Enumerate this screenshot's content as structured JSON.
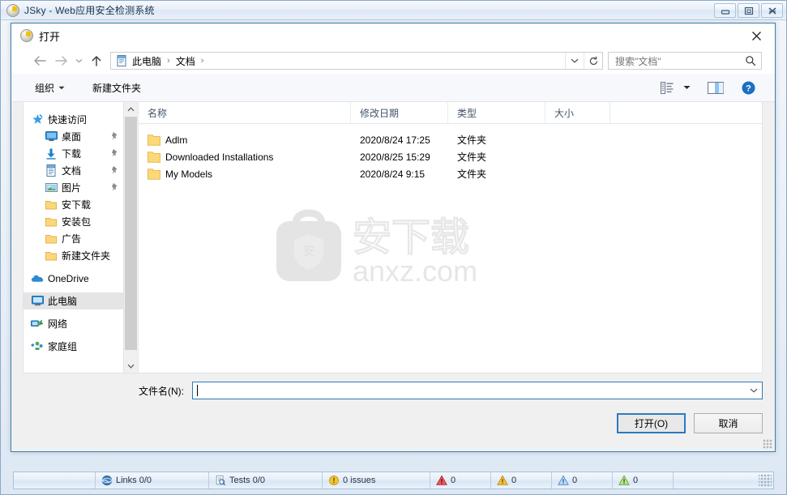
{
  "app": {
    "title": "JSky - Web应用安全检测系统",
    "icon": "jsky-app-icon",
    "window_controls": [
      {
        "name": "minimize-button",
        "glyph": "minimize-icon"
      },
      {
        "name": "maximize-button",
        "glyph": "maximize-icon"
      },
      {
        "name": "close-button",
        "glyph": "close-icon"
      }
    ]
  },
  "dialog": {
    "title": "打开",
    "icon": "jsky-app-icon",
    "close_label": "✕",
    "nav": {
      "back_icon": "arrow-left-icon",
      "forward_icon": "arrow-right-icon",
      "recent_icon": "chevron-down-icon",
      "up_icon": "arrow-up-icon"
    },
    "address": {
      "icon": "documents-icon",
      "crumbs": [
        "此电脑",
        "文档"
      ],
      "separator": "›",
      "dropdown_icon": "chevron-down-icon",
      "refresh_icon": "refresh-icon"
    },
    "search": {
      "placeholder": "搜索\"文档\"",
      "icon": "search-icon"
    },
    "toolbar": {
      "organize": "组织",
      "organize_caret": "▼",
      "new_folder": "新建文件夹",
      "view_icon": "view-list-icon",
      "view_caret": "▼",
      "preview_icon": "preview-pane-icon",
      "help_icon": "help-icon"
    },
    "nav_pane": {
      "items": [
        {
          "label": "快速访问",
          "icon": "quick-access-star-icon",
          "level": 1,
          "pinned": false,
          "selected": false
        },
        {
          "label": "桌面",
          "icon": "desktop-icon",
          "level": 2,
          "pinned": true,
          "selected": false
        },
        {
          "label": "下载",
          "icon": "downloads-icon",
          "level": 2,
          "pinned": true,
          "selected": false
        },
        {
          "label": "文档",
          "icon": "documents-icon",
          "level": 2,
          "pinned": true,
          "selected": false
        },
        {
          "label": "图片",
          "icon": "pictures-icon",
          "level": 2,
          "pinned": true,
          "selected": false
        },
        {
          "label": "安下载",
          "icon": "folder-icon",
          "level": 2,
          "pinned": false,
          "selected": false
        },
        {
          "label": "安装包",
          "icon": "folder-icon",
          "level": 2,
          "pinned": false,
          "selected": false
        },
        {
          "label": "广告",
          "icon": "folder-icon",
          "level": 2,
          "pinned": false,
          "selected": false
        },
        {
          "label": "新建文件夹",
          "icon": "folder-icon",
          "level": 2,
          "pinned": false,
          "selected": false
        },
        {
          "label": "OneDrive",
          "icon": "onedrive-cloud-icon",
          "level": 1,
          "pinned": false,
          "selected": false
        },
        {
          "label": "此电脑",
          "icon": "this-pc-icon",
          "level": 1,
          "pinned": false,
          "selected": true
        },
        {
          "label": "网络",
          "icon": "network-icon",
          "level": 1,
          "pinned": false,
          "selected": false
        },
        {
          "label": "家庭组",
          "icon": "homegroup-icon",
          "level": 1,
          "pinned": false,
          "selected": false
        }
      ],
      "scroll_up_icon": "chevron-up-icon",
      "scroll_down_icon": "chevron-down-icon"
    },
    "file_list": {
      "columns": [
        "名称",
        "修改日期",
        "类型",
        "大小"
      ],
      "sort_column": "名称",
      "sort_direction": "asc",
      "rows": [
        {
          "name": "Adlm",
          "modified": "2020/8/24 17:25",
          "type": "文件夹",
          "size": "",
          "icon": "folder-icon"
        },
        {
          "name": "Downloaded Installations",
          "modified": "2020/8/25 15:29",
          "type": "文件夹",
          "size": "",
          "icon": "folder-icon"
        },
        {
          "name": "My Models",
          "modified": "2020/8/24 9:15",
          "type": "文件夹",
          "size": "",
          "icon": "folder-icon"
        }
      ]
    },
    "watermark": {
      "logo": "anxz-bag-shield-logo",
      "cn_text": "安下载",
      "url_text": "anxz.com"
    },
    "filename": {
      "label": "文件名(N):",
      "value": "",
      "dropdown_icon": "chevron-down-icon"
    },
    "buttons": {
      "open": "打开(O)",
      "cancel": "取消"
    }
  },
  "statusbar": {
    "cells": [
      {
        "label": "Links 0/0",
        "icon": "links-globe-icon"
      },
      {
        "label": "Tests 0/0",
        "icon": "tests-page-icon"
      },
      {
        "label": "0 issues",
        "icon": "issues-warning-icon"
      },
      {
        "label": "0",
        "icon": "severity-high-icon"
      },
      {
        "label": "0",
        "icon": "severity-medium-icon"
      },
      {
        "label": "0",
        "icon": "severity-low-icon"
      },
      {
        "label": "0",
        "icon": "severity-info-icon"
      }
    ],
    "grip": "resize-grip"
  },
  "colors": {
    "accent": "#2a7bbd",
    "titlebar": "#e9f0f9",
    "selection": "#e5e5e5",
    "folder": "#fcd879",
    "severity_high": "#e03b3b",
    "severity_medium": "#f2b705",
    "severity_low": "#6ea8e8",
    "severity_info": "#8fd44a"
  }
}
